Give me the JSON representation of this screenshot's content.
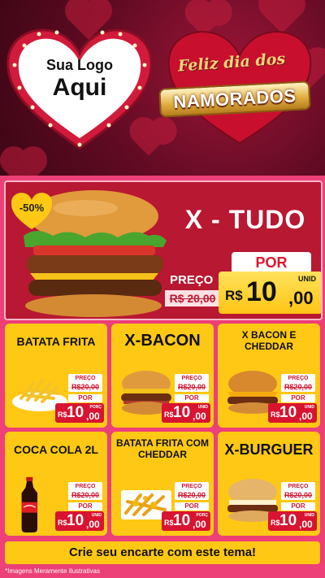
{
  "logo": {
    "line1": "Sua Logo",
    "line2": "Aqui"
  },
  "header": {
    "greeting": "Feliz dia dos",
    "occasion": "NAMORADOS"
  },
  "featured": {
    "name": "X - TUDO",
    "discount": "-50%",
    "preco_label": "PREÇO",
    "old_price": "R$ 20,00",
    "por_label": "POR",
    "currency": "R$",
    "price_int": "10",
    "price_dec": ",00",
    "unit": "UNID"
  },
  "products": [
    {
      "name": "BATATA FRITA",
      "preco_label": "PREÇO",
      "old_price": "R$20,00",
      "por_label": "POR",
      "currency": "R$",
      "price_int": "10",
      "price_dec": ",00",
      "unit": "PORÇ",
      "icon": "fries-icon"
    },
    {
      "name": "X-BACON",
      "preco_label": "PREÇO",
      "old_price": "R$20,00",
      "por_label": "POR",
      "currency": "R$",
      "price_int": "10",
      "price_dec": ",00",
      "unit": "UNID",
      "icon": "burger-icon"
    },
    {
      "name": "X BACON E CHEDDAR",
      "preco_label": "PREÇO",
      "old_price": "R$20,00",
      "por_label": "POR",
      "currency": "R$",
      "price_int": "10",
      "price_dec": ",00",
      "unit": "UNID",
      "icon": "burger-icon"
    },
    {
      "name": "COCA COLA 2L",
      "preco_label": "PREÇO",
      "old_price": "R$20,00",
      "por_label": "POR",
      "currency": "R$",
      "price_int": "10",
      "price_dec": ",00",
      "unit": "UNID",
      "icon": "soda-bottle-icon"
    },
    {
      "name": "BATATA FRITA COM CHEDDAR",
      "preco_label": "PREÇO",
      "old_price": "R$20,00",
      "por_label": "POR",
      "currency": "R$",
      "price_int": "10",
      "price_dec": ",00",
      "unit": "PORÇ",
      "icon": "fries-icon"
    },
    {
      "name": "X-BURGUER",
      "preco_label": "PREÇO",
      "old_price": "R$20,00",
      "por_label": "POR",
      "currency": "R$",
      "price_int": "10",
      "price_dec": ",00",
      "unit": "UNID",
      "icon": "burger-icon"
    }
  ],
  "cta": "Crie seu encarte com este tema!",
  "disclaimer": "*Imagens Meramente Ilustrativas",
  "colors": {
    "brand_red": "#d81430",
    "card_yellow": "#ffc814",
    "panel_pink": "#ed3f78",
    "header_dark": "#5e0a22"
  }
}
